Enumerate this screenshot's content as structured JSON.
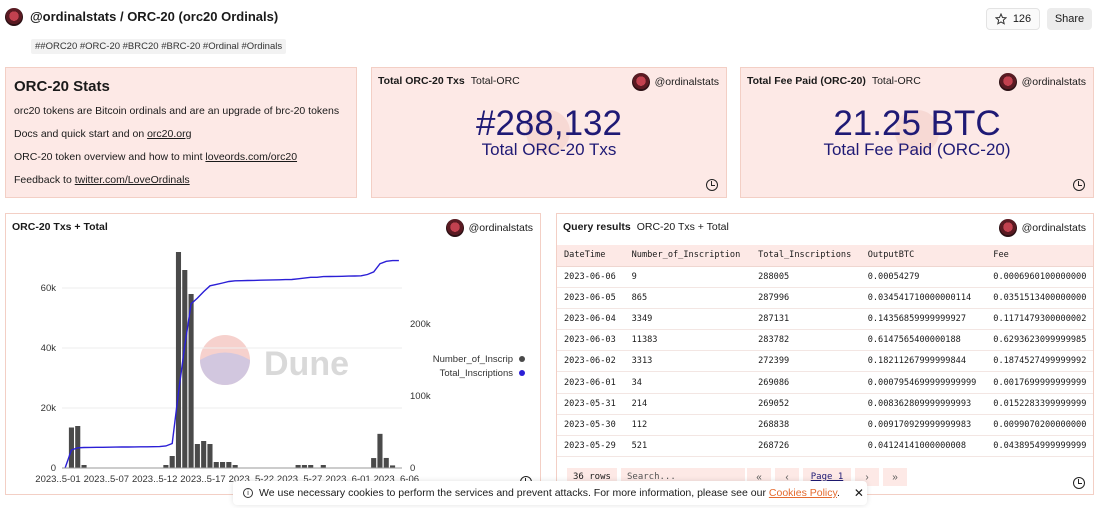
{
  "header": {
    "title": "@ordinalstats / ORC-20 (orc20 Ordinals)",
    "tags": "##ORC20 #ORC-20 #BRC20 #BRC-20 #Ordinal #Ordinals",
    "star_count": "126",
    "share_label": "Share"
  },
  "stats": {
    "title": "ORC-20 Stats",
    "line1": "orc20 tokens are Bitcoin ordinals and are an upgrade of brc-20 tokens",
    "line2_prefix": "Docs and quick start and on ",
    "line2_link": "orc20.org",
    "line3_prefix": "ORC-20 token overview and how to mint ",
    "line3_link": "loveords.com/orc20",
    "line4_prefix": "Feedback to ",
    "line4_link": "twitter.com/LoveOrdinals"
  },
  "owner": "@ordinalstats",
  "counter1": {
    "title": "Total ORC-20 Txs",
    "subtitle": "Total-ORC",
    "value": "#288,132",
    "label": "Total ORC-20 Txs"
  },
  "counter2": {
    "title": "Total Fee Paid (ORC-20)",
    "subtitle": "Total-ORC",
    "value": "21.25 BTC",
    "label": "Total Fee Paid (ORC-20)"
  },
  "chart": {
    "title": "ORC-20 Txs + Total",
    "watermark": "Dune"
  },
  "chart_data": {
    "type": "bar",
    "title": "ORC-20 Txs + Total",
    "x_tick_labels": [
      "2023..5-01",
      "2023..5-07",
      "2023..5-12",
      "2023..5-17",
      "2023..5-22",
      "2023..5-27",
      "2023..6-01",
      "2023..6-06"
    ],
    "left_axis_ticks": [
      "0",
      "20k",
      "40k",
      "60k"
    ],
    "right_axis_ticks": [
      "0",
      "100k",
      "200k"
    ],
    "left_ylim": [
      0,
      72000
    ],
    "right_ylim": [
      0,
      300000
    ],
    "legend_position": "right",
    "series": [
      {
        "name": "Number_of_Inscrip",
        "type": "bar",
        "color": "#4a4a4a",
        "values": [
          0,
          13500,
          14000,
          1000,
          0,
          0,
          0,
          0,
          0,
          0,
          0,
          0,
          0,
          0,
          0,
          0,
          1000,
          4000,
          72000,
          66000,
          58000,
          8000,
          9000,
          8000,
          2000,
          2000,
          2000,
          1000,
          0,
          0,
          0,
          0,
          0,
          0,
          0,
          0,
          0,
          1000,
          1000,
          1000,
          0,
          1000,
          0,
          0,
          0,
          0,
          0,
          0,
          0,
          3313,
          11383,
          3349,
          865,
          9
        ]
      },
      {
        "name": "Total_Inscriptions",
        "type": "line",
        "color": "#2b1fd6",
        "values": [
          0,
          25000,
          28000,
          28500,
          28600,
          28700,
          28800,
          28900,
          29000,
          29100,
          29200,
          29300,
          29400,
          29500,
          29600,
          29700,
          30500,
          34000,
          105000,
          170000,
          228000,
          236000,
          245000,
          253000,
          255000,
          257000,
          259000,
          260000,
          260200,
          260400,
          260600,
          260800,
          261000,
          261200,
          261400,
          261600,
          261800,
          262800,
          263800,
          264800,
          264900,
          265900,
          266000,
          266100,
          266300,
          266500,
          266700,
          266900,
          268726,
          272399,
          283782,
          287131,
          287996,
          288005
        ]
      }
    ]
  },
  "table": {
    "title": "Query results",
    "subtitle": "ORC-20 Txs + Total",
    "columns": [
      "DateTime",
      "Number_of_Inscription",
      "Total_Inscriptions",
      "OutputBTC",
      "Fee"
    ],
    "rows": [
      [
        "2023-06-06",
        "9",
        "288005",
        "0.00054279",
        "0.0006960100000000"
      ],
      [
        "2023-06-05",
        "865",
        "287996",
        "0.034541710000000114",
        "0.0351513400000000"
      ],
      [
        "2023-06-04",
        "3349",
        "287131",
        "0.14356859999999927",
        "0.1171479300000002"
      ],
      [
        "2023-06-03",
        "11383",
        "283782",
        "0.6147565400000188",
        "0.6293623099999985"
      ],
      [
        "2023-06-02",
        "3313",
        "272399",
        "0.18211267999999844",
        "0.1874527499999992"
      ],
      [
        "2023-06-01",
        "34",
        "269086",
        "0.0007954699999999999",
        "0.0017699999999999"
      ],
      [
        "2023-05-31",
        "214",
        "269052",
        "0.008362809999999993",
        "0.0152283399999999"
      ],
      [
        "2023-05-30",
        "112",
        "268838",
        "0.009170929999999983",
        "0.0099070200000000"
      ],
      [
        "2023-05-29",
        "521",
        "268726",
        "0.04124141000000008",
        "0.0438954999999999"
      ]
    ],
    "row_count": "36 rows",
    "search_placeholder": "Search...",
    "page_label": "Page 1"
  },
  "cookie": {
    "text": "We use necessary cookies to perform the services and prevent attacks. For more information, please see our ",
    "link": "Cookies Policy",
    "suffix": "."
  }
}
